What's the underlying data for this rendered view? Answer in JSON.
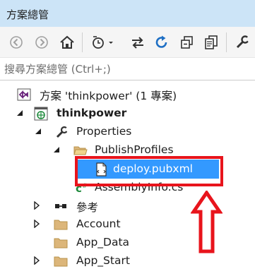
{
  "panel": {
    "title": "方案總管"
  },
  "toolbar": {
    "buttons": [
      {
        "name": "back-icon"
      },
      {
        "name": "forward-icon"
      },
      {
        "name": "home-icon"
      },
      {
        "name": "history-icon"
      },
      {
        "name": "sync-icon"
      },
      {
        "name": "refresh-icon"
      },
      {
        "name": "collapse-all-icon"
      },
      {
        "name": "show-all-files-icon"
      },
      {
        "name": "properties-wrench-icon"
      }
    ]
  },
  "search": {
    "placeholder": "搜尋方案總管 (Ctrl+;)"
  },
  "tree": {
    "solution": "方案 'thinkpower' (1 專案)",
    "project": "thinkpower",
    "properties": "Properties",
    "publish_profiles": "PublishProfiles",
    "deploy": "deploy.pubxml",
    "assembly_info": "AssemblyInfo.cs",
    "references": "參考",
    "account": "Account",
    "app_data": "App_Data",
    "app_start": "App_Start"
  },
  "colors": {
    "selection": "#3399ff",
    "annotation_red": "#e8141c",
    "folder": "#dcb67a",
    "vs_purple": "#68217a"
  }
}
